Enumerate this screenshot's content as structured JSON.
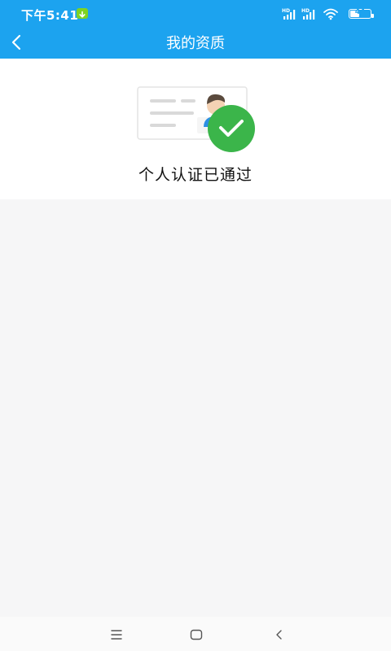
{
  "status_bar": {
    "time": "下午5:41",
    "battery_level": "44",
    "icons": [
      "download-notification-icon",
      "hd-signal-icon",
      "hd-signal-icon",
      "wifi-icon",
      "battery-icon"
    ]
  },
  "header": {
    "title": "我的资质",
    "back_icon": "chevron-left-icon"
  },
  "qualification": {
    "status_text": "个人认证已通过",
    "illustration_icon": "id-card-verified-icon"
  },
  "system_nav": {
    "icons": [
      "menu-icon",
      "home-icon",
      "back-icon"
    ]
  },
  "colors": {
    "primary": "#1ca3ef",
    "success": "#3bb54a",
    "background": "#f6f6f7"
  }
}
